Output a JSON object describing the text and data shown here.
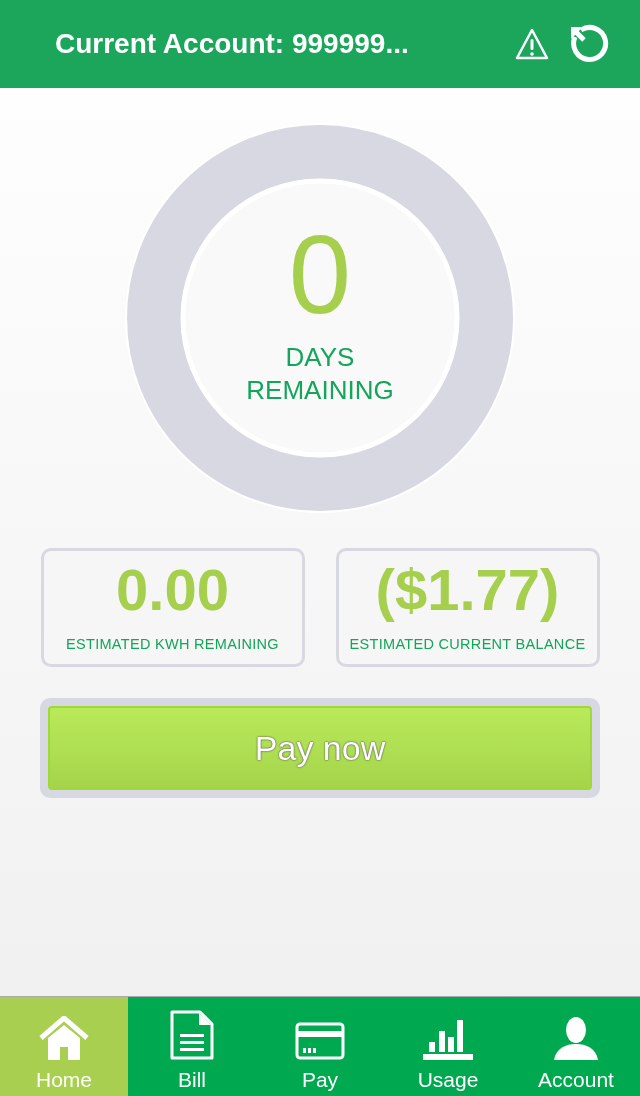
{
  "header": {
    "title": "Current Account: 999999..."
  },
  "countdown": {
    "value": "0",
    "label_line_1": "DAYS",
    "label_line_2": "REMAINING",
    "level": 0
  },
  "stats": [
    {
      "value": "0.00",
      "label": "ESTIMATED KWH REMAINING"
    },
    {
      "value": "($1.77)",
      "label": "ESTIMATED CURRENT BALANCE"
    }
  ],
  "pay_button": {
    "label": "Pay now"
  },
  "tabs": [
    {
      "label": "Home",
      "selected": true
    },
    {
      "label": "Bill",
      "selected": false
    },
    {
      "label": "Pay",
      "selected": false
    },
    {
      "label": "Usage",
      "selected": false
    },
    {
      "label": "Account",
      "selected": false
    }
  ]
}
